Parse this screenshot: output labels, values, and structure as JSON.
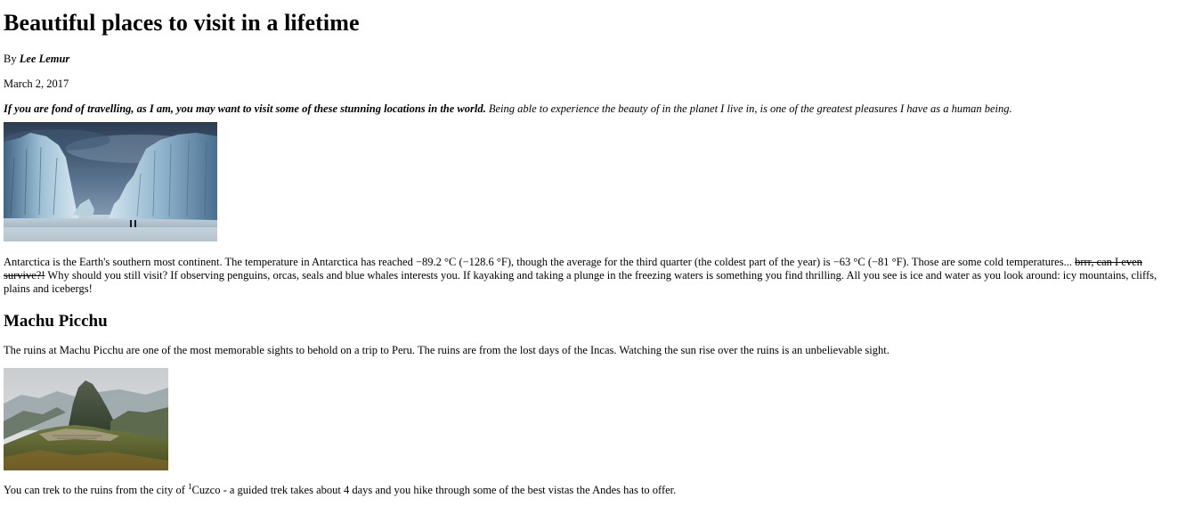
{
  "article": {
    "title": "Beautiful places to visit in a lifetime",
    "by_prefix": "By",
    "author": "Lee Lemur",
    "date": "March 2, 2017",
    "intro_bold": "If you are fond of travelling, as I am, you may want to visit some of these stunning locations in the world.",
    "intro_rest": " Being able to experience the beauty of in the planet I live in, is one of the greatest pleasures I have as a human being.",
    "antarctica_para_1": "Antarctica is the Earth's southern most continent. The temperature in Antarctica has reached −89.2 °C (−128.6 °F), though the average for the third quarter (the coldest part of the year) is −63 °C (−81 °F). Those are some cold temperatures... ",
    "antarctica_strike": "brrr, can I even survive?!",
    "antarctica_para_2": " Why should you still visit? If observing penguins, orcas, seals and blue whales interests you. If kayaking and taking a plunge in the freezing waters is something you find thrilling. All you see is ice and water as you look around: icy mountains, cliffs, plains and icebergs!",
    "machu_heading": "Machu Picchu",
    "machu_para": "The ruins at Machu Picchu are one of the most memorable sights to behold on a trip to Peru. The ruins are from the lost days of the Incas. Watching the sun rise over the ruins is an unbelievable sight.",
    "trek_para_1": "You can trek to the ruins from the city of ",
    "trek_sup": "1",
    "trek_para_2": "Cuzco - a guided trek takes about 4 days and you hike through some of the best vistas the Andes has to offer."
  }
}
